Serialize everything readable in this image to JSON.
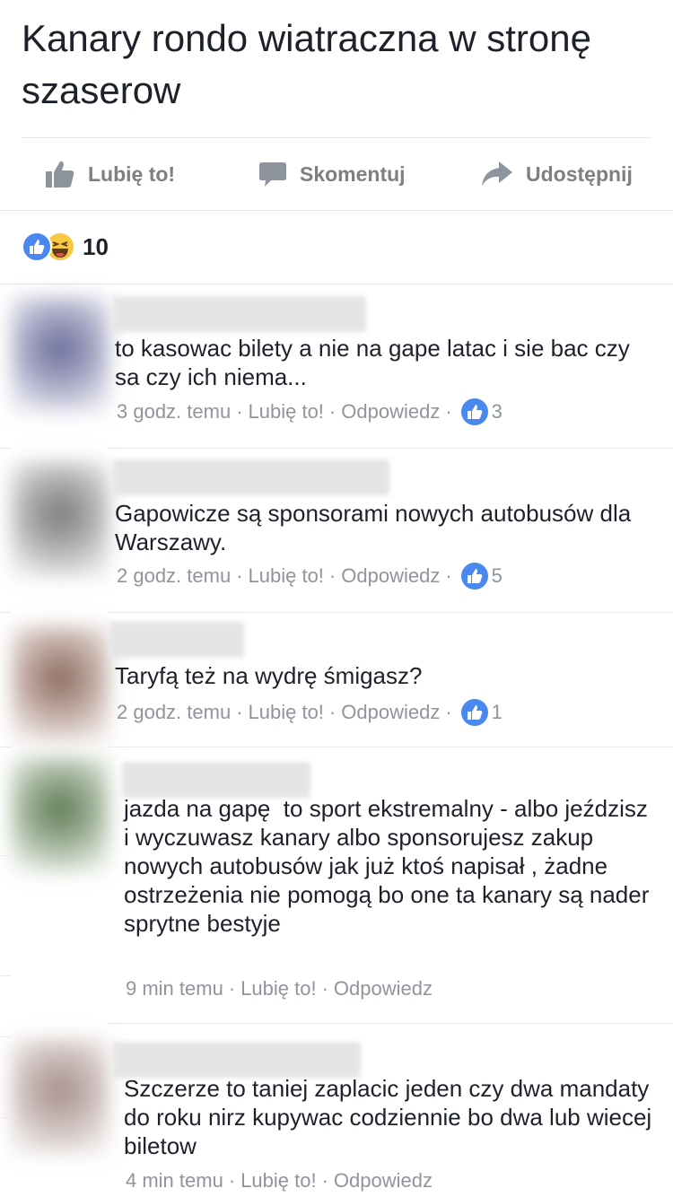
{
  "post": {
    "title": "Kanary rondo wiatraczna w stronę szaserow"
  },
  "actions": {
    "like": "Lubię to!",
    "comment": "Skomentuj",
    "share": "Udostępnij"
  },
  "reactions": {
    "count": "10",
    "types": [
      "like-icon",
      "haha-icon"
    ]
  },
  "colors": {
    "accent": "#4a87ee",
    "meta": "#90949c",
    "action": "#7f7f7f"
  },
  "comments": [
    {
      "text": "to kasowac bilety a nie na gape latac i sie bac czy sa czy ich niema...",
      "time": "3 godz. temu",
      "like": "Lubię to!",
      "reply": "Odpowiedz",
      "likes": "3"
    },
    {
      "text": "Gapowicze są sponsorami nowych autobusów dla Warszawy.",
      "time": "2 godz. temu",
      "like": "Lubię to!",
      "reply": "Odpowiedz",
      "likes": "5"
    },
    {
      "text": "Taryfą też na wydrę śmigasz?",
      "time": "2 godz. temu",
      "like": "Lubię to!",
      "reply": "Odpowiedz",
      "likes": "1"
    },
    {
      "text": "jazda na gapę  to sport ekstremalny - albo jeździsz i wyczuwasz kanary albo sponsorujesz zakup nowych autobusów jak już ktoś napisał , żadne ostrzeżenia nie pomogą bo one ta kanary są nader sprytne bestyje",
      "time": "9 min temu",
      "like": "Lubię to!",
      "reply": "Odpowiedz"
    },
    {
      "text": "Szczerze to taniej zaplacic jeden czy dwa mandaty do roku nirz kupywac codziennie bo dwa lub wiecej biletow",
      "time": "4 min temu",
      "like": "Lubię to!",
      "reply": "Odpowiedz"
    }
  ]
}
